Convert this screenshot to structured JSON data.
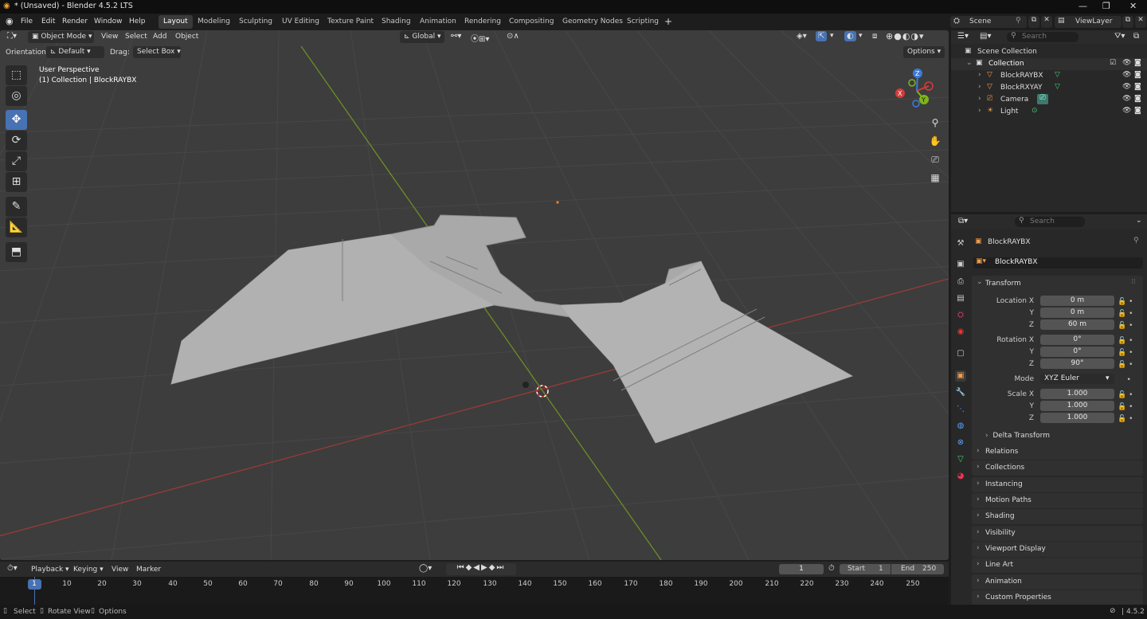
{
  "window": {
    "title": "* (Unsaved) - Blender 4.5.2 LTS"
  },
  "menu": [
    "File",
    "Edit",
    "Render",
    "Window",
    "Help"
  ],
  "workspaces": [
    "Layout",
    "Modeling",
    "Sculpting",
    "UV Editing",
    "Texture Paint",
    "Shading",
    "Animation",
    "Rendering",
    "Compositing",
    "Geometry Nodes",
    "Scripting"
  ],
  "active_workspace": "Layout",
  "top_right": {
    "scene": "Scene",
    "viewlayer": "ViewLayer"
  },
  "viewport": {
    "mode": "Object Mode",
    "menus": [
      "View",
      "Select",
      "Add",
      "Object"
    ],
    "transform_orientation": "Global",
    "orientation_label": "Orientation:",
    "orientation_value": "Default",
    "drag_label": "Drag:",
    "drag_value": "Select Box",
    "options": "Options",
    "overlay_line1": "User Perspective",
    "overlay_line2": "(1) Collection | BlockRAYBX",
    "gizmo": {
      "x": "X",
      "y": "Y",
      "z": "Z"
    }
  },
  "outliner": {
    "search_placeholder": "Search",
    "scene_collection": "Scene Collection",
    "collection": "Collection",
    "items": [
      "BlockRAYBX",
      "BlockRXYAY",
      "Camera",
      "Light"
    ]
  },
  "properties": {
    "search_placeholder": "Search",
    "object_name": "BlockRAYBX",
    "data_name": "BlockRAYBX",
    "transform_header": "Transform",
    "location_label": "Location X",
    "rotation_label": "Rotation X",
    "scale_label": "Scale X",
    "y_label": "Y",
    "z_label": "Z",
    "location": [
      "0 m",
      "0 m",
      "60 m"
    ],
    "rotation": [
      "0°",
      "0°",
      "90°"
    ],
    "mode_label": "Mode",
    "mode_value": "XYZ Euler",
    "scale": [
      "1.000",
      "1.000",
      "1.000"
    ],
    "delta": "Delta Transform",
    "panels": [
      "Relations",
      "Collections",
      "Instancing",
      "Motion Paths",
      "Shading",
      "Visibility",
      "Viewport Display",
      "Line Art",
      "Animation",
      "Custom Properties"
    ]
  },
  "timeline": {
    "menus": [
      "Playback",
      "Keying",
      "View",
      "Marker"
    ],
    "current_frame": "1",
    "start_label": "Start",
    "start": "1",
    "end_label": "End",
    "end": "250",
    "ticks": [
      "1",
      "10",
      "20",
      "30",
      "40",
      "50",
      "60",
      "70",
      "80",
      "90",
      "100",
      "110",
      "120",
      "130",
      "140",
      "150",
      "160",
      "170",
      "180",
      "190",
      "200",
      "210",
      "220",
      "230",
      "240",
      "250"
    ]
  },
  "status": {
    "select": "Select",
    "rotate": "Rotate View",
    "options": "Options",
    "version": "4.5.2"
  }
}
